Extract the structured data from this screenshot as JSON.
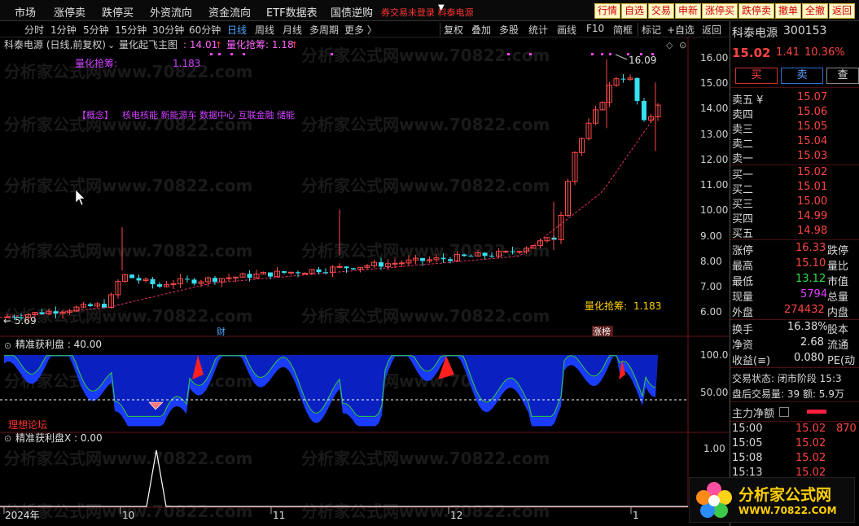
{
  "menubar": {
    "items": [
      "市场",
      "涨停卖",
      "跌停买",
      "外资流向",
      "资金流向",
      "ETF数据表",
      "国债逆购"
    ],
    "alert": "券交易未登录  科泰电源",
    "quick": [
      "行情",
      "自选",
      "交易",
      "申新",
      "涨停买",
      "跌停卖",
      "撤单",
      "全撤",
      "返回"
    ]
  },
  "periods": [
    "分时",
    "1分钟",
    "5分钟",
    "15分钟",
    "30分钟",
    "60分钟",
    "日线",
    "周线",
    "月线",
    "多周期",
    "更多 〉"
  ],
  "tools": [
    "复权",
    "叠加",
    "多股",
    "统计",
    "画线",
    "F10",
    "简框",
    "标记",
    "+自选",
    "返回"
  ],
  "chart": {
    "title_stock": "科泰电源 (日线,前复权)",
    "indicator_name": "量化起飞主图",
    "ind_val1": ": 14.01",
    "ind_val2": "量化抢筹: 1.18",
    "qlabel_tl": "量化抢筹:",
    "qval_tl": "1.183",
    "concept_tag": "【概念】",
    "concepts": "核电核能 新能源车 数据中心 互联金融 储能",
    "qlabel_br": "量化抢筹:",
    "qval_br": "1.183",
    "high_mark": "16.09",
    "low_mark": "← 5.69",
    "badge_cai": "财",
    "badge_zhangbang": "涨榜",
    "y_ticks": [
      "16.00",
      "15.00",
      "14.00",
      "13.00",
      "12.00",
      "11.00",
      "10.00",
      "9.00",
      "8.00",
      "7.00",
      "6.00"
    ],
    "watermark": "分析家公式网www.70822.com"
  },
  "panel2": {
    "title": "精准获利盘 : 40.00",
    "y_ticks": [
      "100.0",
      "50.00"
    ],
    "label": "理想论坛"
  },
  "panel3": {
    "title": "精准获利盘X : 0.00",
    "y_ticks": [
      "1.00"
    ]
  },
  "time_axis": {
    "labels": [
      "2024年",
      "10",
      "11",
      "12",
      "1"
    ]
  },
  "right_panel": {
    "name": "科泰电源",
    "code": "300153",
    "price": "15.02",
    "change": "1.41",
    "pct": "10.36%",
    "buy_btn": "买",
    "sell_btn": "卖",
    "query_btn": "查",
    "asks": [
      {
        "label": "卖五 ¥",
        "price": "15.07"
      },
      {
        "label": "卖四",
        "price": "15.06"
      },
      {
        "label": "卖三",
        "price": "15.05"
      },
      {
        "label": "卖二",
        "price": "15.04"
      },
      {
        "label": "卖一",
        "price": "15.03"
      }
    ],
    "bids": [
      {
        "label": "买一",
        "price": "15.02"
      },
      {
        "label": "买二",
        "price": "15.01"
      },
      {
        "label": "买三",
        "price": "15.00"
      },
      {
        "label": "买四",
        "price": "14.99"
      },
      {
        "label": "买五",
        "price": "14.98"
      }
    ],
    "stats": [
      {
        "l": "涨停",
        "v": "16.33",
        "r": "跌停"
      },
      {
        "l": "最高",
        "v": "15.10",
        "r": "量比"
      },
      {
        "l": "最低",
        "v": "13.12",
        "r": "市值"
      },
      {
        "l": "现量",
        "v": "5794",
        "r": "总量"
      },
      {
        "l": "外盘",
        "v": "274432",
        "r": "内盘"
      },
      {
        "l": "换手",
        "v": "16.38%",
        "r": "股本"
      },
      {
        "l": "净资",
        "v": "2.68",
        "r": "流通"
      },
      {
        "l": "收益(≡)",
        "v": "0.080",
        "r": "PE(动"
      }
    ],
    "trade_state": "交易状态: 闭市阶段 15:3",
    "after_hours": "盘后交易量: 39  额: 5.9万",
    "net_flow": "主力净额",
    "ticks": [
      {
        "t": "15:00",
        "p": "15.02",
        "v": "870"
      },
      {
        "t": "15:05",
        "p": "15.02",
        "v": ""
      },
      {
        "t": "15:08",
        "p": "15.02",
        "v": ""
      },
      {
        "t": "15:13",
        "p": "15.02",
        "v": ""
      }
    ]
  },
  "logo": {
    "title": "分析家公式网",
    "url": "WWW.70822.COM"
  }
}
